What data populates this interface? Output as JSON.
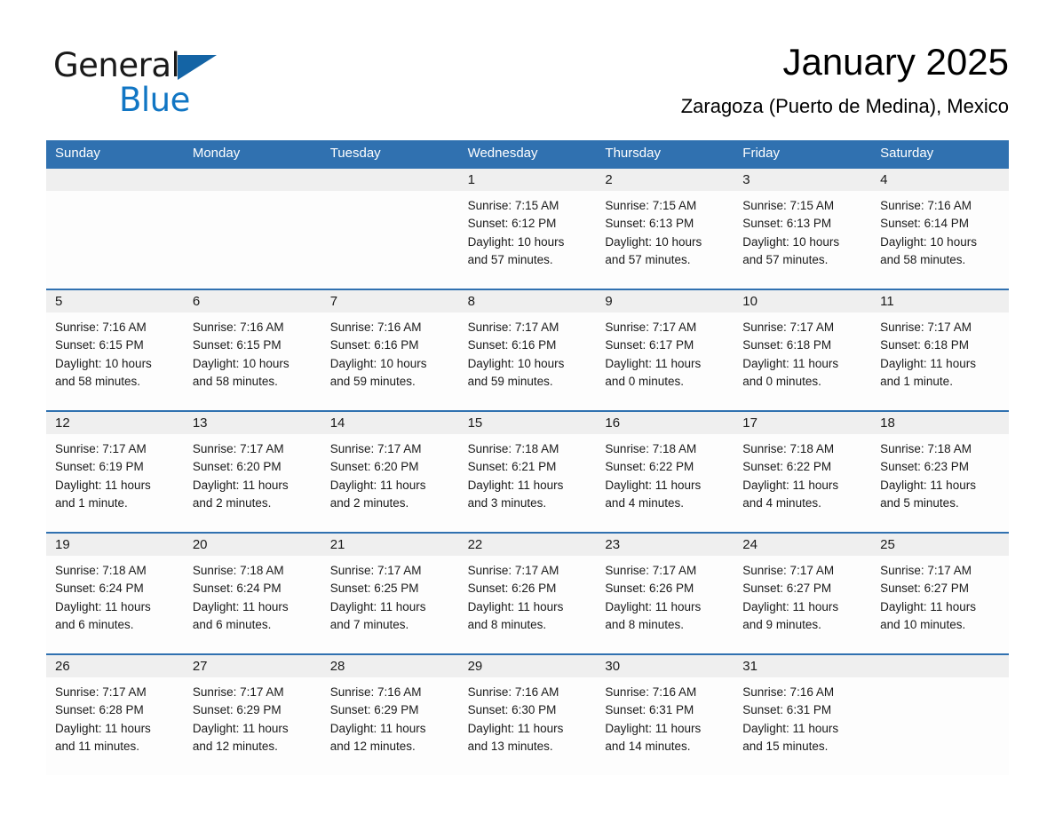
{
  "brand": {
    "name_part1": "General",
    "name_part2": "Blue",
    "triangle_icon": "triangle-icon",
    "accent_color": "#1176c4",
    "logo_triangle_color": "#1464a5"
  },
  "header": {
    "title": "January 2025",
    "subtitle": "Zaragoza (Puerto de Medina), Mexico"
  },
  "theme": {
    "header_blue": "#3071b0",
    "daynum_band_gray": "#efefef",
    "page_background": "#ffffff"
  },
  "calendar": {
    "weekdays": [
      "Sunday",
      "Monday",
      "Tuesday",
      "Wednesday",
      "Thursday",
      "Friday",
      "Saturday"
    ],
    "weeks": [
      [
        {
          "day": "",
          "empty": true
        },
        {
          "day": "",
          "empty": true
        },
        {
          "day": "",
          "empty": true
        },
        {
          "day": "1",
          "sunrise": "Sunrise: 7:15 AM",
          "sunset": "Sunset: 6:12 PM",
          "daylight_line1": "Daylight: 10 hours",
          "daylight_line2": "and 57 minutes."
        },
        {
          "day": "2",
          "sunrise": "Sunrise: 7:15 AM",
          "sunset": "Sunset: 6:13 PM",
          "daylight_line1": "Daylight: 10 hours",
          "daylight_line2": "and 57 minutes."
        },
        {
          "day": "3",
          "sunrise": "Sunrise: 7:15 AM",
          "sunset": "Sunset: 6:13 PM",
          "daylight_line1": "Daylight: 10 hours",
          "daylight_line2": "and 57 minutes."
        },
        {
          "day": "4",
          "sunrise": "Sunrise: 7:16 AM",
          "sunset": "Sunset: 6:14 PM",
          "daylight_line1": "Daylight: 10 hours",
          "daylight_line2": "and 58 minutes."
        }
      ],
      [
        {
          "day": "5",
          "sunrise": "Sunrise: 7:16 AM",
          "sunset": "Sunset: 6:15 PM",
          "daylight_line1": "Daylight: 10 hours",
          "daylight_line2": "and 58 minutes."
        },
        {
          "day": "6",
          "sunrise": "Sunrise: 7:16 AM",
          "sunset": "Sunset: 6:15 PM",
          "daylight_line1": "Daylight: 10 hours",
          "daylight_line2": "and 58 minutes."
        },
        {
          "day": "7",
          "sunrise": "Sunrise: 7:16 AM",
          "sunset": "Sunset: 6:16 PM",
          "daylight_line1": "Daylight: 10 hours",
          "daylight_line2": "and 59 minutes."
        },
        {
          "day": "8",
          "sunrise": "Sunrise: 7:17 AM",
          "sunset": "Sunset: 6:16 PM",
          "daylight_line1": "Daylight: 10 hours",
          "daylight_line2": "and 59 minutes."
        },
        {
          "day": "9",
          "sunrise": "Sunrise: 7:17 AM",
          "sunset": "Sunset: 6:17 PM",
          "daylight_line1": "Daylight: 11 hours",
          "daylight_line2": "and 0 minutes."
        },
        {
          "day": "10",
          "sunrise": "Sunrise: 7:17 AM",
          "sunset": "Sunset: 6:18 PM",
          "daylight_line1": "Daylight: 11 hours",
          "daylight_line2": "and 0 minutes."
        },
        {
          "day": "11",
          "sunrise": "Sunrise: 7:17 AM",
          "sunset": "Sunset: 6:18 PM",
          "daylight_line1": "Daylight: 11 hours",
          "daylight_line2": "and 1 minute."
        }
      ],
      [
        {
          "day": "12",
          "sunrise": "Sunrise: 7:17 AM",
          "sunset": "Sunset: 6:19 PM",
          "daylight_line1": "Daylight: 11 hours",
          "daylight_line2": "and 1 minute."
        },
        {
          "day": "13",
          "sunrise": "Sunrise: 7:17 AM",
          "sunset": "Sunset: 6:20 PM",
          "daylight_line1": "Daylight: 11 hours",
          "daylight_line2": "and 2 minutes."
        },
        {
          "day": "14",
          "sunrise": "Sunrise: 7:17 AM",
          "sunset": "Sunset: 6:20 PM",
          "daylight_line1": "Daylight: 11 hours",
          "daylight_line2": "and 2 minutes."
        },
        {
          "day": "15",
          "sunrise": "Sunrise: 7:18 AM",
          "sunset": "Sunset: 6:21 PM",
          "daylight_line1": "Daylight: 11 hours",
          "daylight_line2": "and 3 minutes."
        },
        {
          "day": "16",
          "sunrise": "Sunrise: 7:18 AM",
          "sunset": "Sunset: 6:22 PM",
          "daylight_line1": "Daylight: 11 hours",
          "daylight_line2": "and 4 minutes."
        },
        {
          "day": "17",
          "sunrise": "Sunrise: 7:18 AM",
          "sunset": "Sunset: 6:22 PM",
          "daylight_line1": "Daylight: 11 hours",
          "daylight_line2": "and 4 minutes."
        },
        {
          "day": "18",
          "sunrise": "Sunrise: 7:18 AM",
          "sunset": "Sunset: 6:23 PM",
          "daylight_line1": "Daylight: 11 hours",
          "daylight_line2": "and 5 minutes."
        }
      ],
      [
        {
          "day": "19",
          "sunrise": "Sunrise: 7:18 AM",
          "sunset": "Sunset: 6:24 PM",
          "daylight_line1": "Daylight: 11 hours",
          "daylight_line2": "and 6 minutes."
        },
        {
          "day": "20",
          "sunrise": "Sunrise: 7:18 AM",
          "sunset": "Sunset: 6:24 PM",
          "daylight_line1": "Daylight: 11 hours",
          "daylight_line2": "and 6 minutes."
        },
        {
          "day": "21",
          "sunrise": "Sunrise: 7:17 AM",
          "sunset": "Sunset: 6:25 PM",
          "daylight_line1": "Daylight: 11 hours",
          "daylight_line2": "and 7 minutes."
        },
        {
          "day": "22",
          "sunrise": "Sunrise: 7:17 AM",
          "sunset": "Sunset: 6:26 PM",
          "daylight_line1": "Daylight: 11 hours",
          "daylight_line2": "and 8 minutes."
        },
        {
          "day": "23",
          "sunrise": "Sunrise: 7:17 AM",
          "sunset": "Sunset: 6:26 PM",
          "daylight_line1": "Daylight: 11 hours",
          "daylight_line2": "and 8 minutes."
        },
        {
          "day": "24",
          "sunrise": "Sunrise: 7:17 AM",
          "sunset": "Sunset: 6:27 PM",
          "daylight_line1": "Daylight: 11 hours",
          "daylight_line2": "and 9 minutes."
        },
        {
          "day": "25",
          "sunrise": "Sunrise: 7:17 AM",
          "sunset": "Sunset: 6:27 PM",
          "daylight_line1": "Daylight: 11 hours",
          "daylight_line2": "and 10 minutes."
        }
      ],
      [
        {
          "day": "26",
          "sunrise": "Sunrise: 7:17 AM",
          "sunset": "Sunset: 6:28 PM",
          "daylight_line1": "Daylight: 11 hours",
          "daylight_line2": "and 11 minutes."
        },
        {
          "day": "27",
          "sunrise": "Sunrise: 7:17 AM",
          "sunset": "Sunset: 6:29 PM",
          "daylight_line1": "Daylight: 11 hours",
          "daylight_line2": "and 12 minutes."
        },
        {
          "day": "28",
          "sunrise": "Sunrise: 7:16 AM",
          "sunset": "Sunset: 6:29 PM",
          "daylight_line1": "Daylight: 11 hours",
          "daylight_line2": "and 12 minutes."
        },
        {
          "day": "29",
          "sunrise": "Sunrise: 7:16 AM",
          "sunset": "Sunset: 6:30 PM",
          "daylight_line1": "Daylight: 11 hours",
          "daylight_line2": "and 13 minutes."
        },
        {
          "day": "30",
          "sunrise": "Sunrise: 7:16 AM",
          "sunset": "Sunset: 6:31 PM",
          "daylight_line1": "Daylight: 11 hours",
          "daylight_line2": "and 14 minutes."
        },
        {
          "day": "31",
          "sunrise": "Sunrise: 7:16 AM",
          "sunset": "Sunset: 6:31 PM",
          "daylight_line1": "Daylight: 11 hours",
          "daylight_line2": "and 15 minutes."
        },
        {
          "day": "",
          "empty": true
        }
      ]
    ]
  }
}
